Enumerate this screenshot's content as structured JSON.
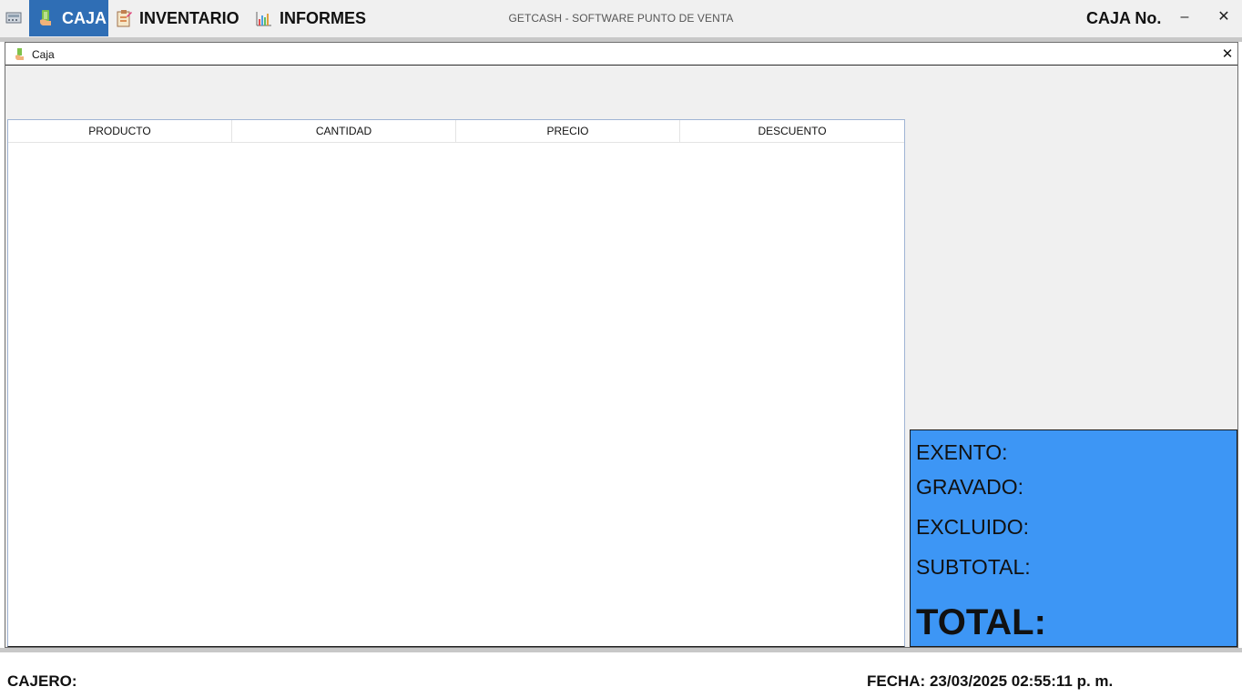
{
  "topbar": {
    "app_icon": "cash-register-icon",
    "menu": [
      {
        "label": "CAJA",
        "icon": "cash-hand-icon",
        "active": true
      },
      {
        "label": "INVENTARIO",
        "icon": "clipboard-icon",
        "active": false
      },
      {
        "label": "INFORMES",
        "icon": "bar-chart-icon",
        "active": false
      }
    ],
    "title": "GETCASH - SOFTWARE PUNTO DE VENTA",
    "caja_no": "CAJA No.",
    "minimize": "–",
    "close": "✕",
    "active_color": "#2f6eb5"
  },
  "child": {
    "title": "Caja",
    "close": "✕",
    "icon": "cash-hand-icon"
  },
  "grid": {
    "columns": [
      "PRODUCTO",
      "CANTIDAD",
      "PRECIO",
      "DESCUENTO"
    ],
    "rows": []
  },
  "totals": {
    "exento": "EXENTO:",
    "gravado": "GRAVADO:",
    "excluido": "EXCLUIDO:",
    "subtotal": "SUBTOTAL:",
    "total": "TOTAL:",
    "panel_color": "#3d96f5"
  },
  "status": {
    "cajero": "CAJERO:",
    "fecha": "FECHA: 23/03/2025 02:55:11 p. m."
  }
}
